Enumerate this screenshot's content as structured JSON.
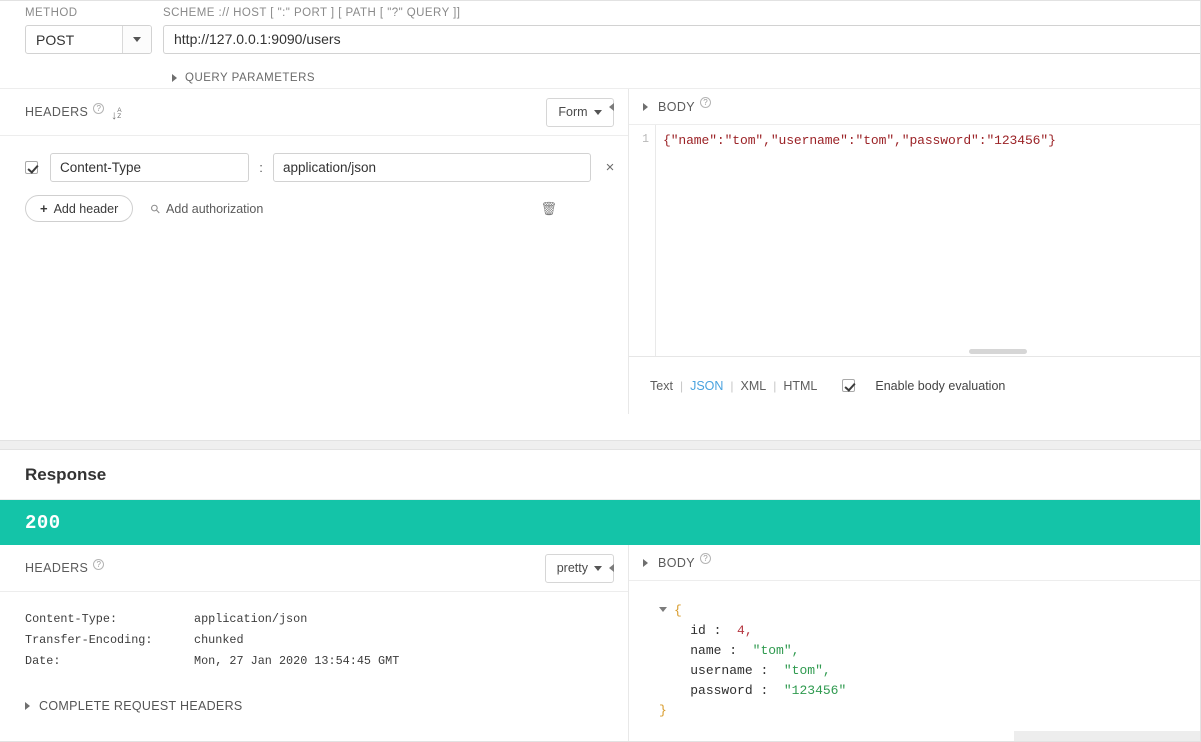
{
  "request": {
    "method_label": "METHOD",
    "method_value": "POST",
    "url_label": "SCHEME :// HOST [ \":\" PORT ] [ PATH [ \"?\" QUERY ]]",
    "url_value": "http://127.0.0.1:9090/users",
    "query_parameters_label": "QUERY PARAMETERS",
    "headers": {
      "title": "HEADERS",
      "help_icon": "help-icon",
      "sort_icon": "sort-az-icon",
      "mode_value": "Form",
      "rows": [
        {
          "enabled": true,
          "key": "Content-Type",
          "separator": ":",
          "value": "application/json",
          "remove_label": "×"
        }
      ],
      "add_header_label": "Add header",
      "add_header_plus": "+",
      "add_authorization_label": "Add authorization",
      "authorization_icon": "key-icon",
      "delete_all_icon": "trash-icon",
      "collapse_left_icon": "collapse-left-icon"
    },
    "body": {
      "title": "BODY",
      "help_icon": "help-icon",
      "expand_icon": "expand-right-icon",
      "line_number": "1",
      "content": "{\"name\":\"tom\",\"username\":\"tom\",\"password\":\"123456\"}",
      "formats": [
        {
          "label": "Text",
          "active": false
        },
        {
          "label": "JSON",
          "active": true
        },
        {
          "label": "XML",
          "active": false
        },
        {
          "label": "HTML",
          "active": false
        }
      ],
      "format_separator": "|",
      "enable_evaluation_label": "Enable body evaluation",
      "enable_evaluation_checked": true
    }
  },
  "response": {
    "title": "Response",
    "status_code": "200",
    "status_color": "#14c4a8",
    "headers": {
      "title": "HEADERS",
      "help_icon": "help-icon",
      "mode_value": "pretty",
      "collapse_left_icon": "collapse-left-icon",
      "rows": [
        {
          "key": "Content-Type:",
          "value": "application/json"
        },
        {
          "key": "Transfer-Encoding:",
          "value": "chunked"
        },
        {
          "key": "Date:",
          "value": "Mon, 27 Jan 2020 13:54:45 GMT"
        }
      ],
      "complete_request_headers_label": "COMPLETE REQUEST HEADERS"
    },
    "body": {
      "title": "BODY",
      "help_icon": "help-icon",
      "expand_icon": "expand-right-icon",
      "open_brace": "{",
      "close_brace": "}",
      "entries": [
        {
          "key": "id",
          "sep": " :  ",
          "value": "4,",
          "type": "number"
        },
        {
          "key": "name",
          "sep": " :  ",
          "value": "\"tom\",",
          "type": "string"
        },
        {
          "key": "username",
          "sep": " :  ",
          "value": "\"tom\",",
          "type": "string"
        },
        {
          "key": "password",
          "sep": " :  ",
          "value": "\"123456\"",
          "type": "string"
        }
      ]
    }
  }
}
